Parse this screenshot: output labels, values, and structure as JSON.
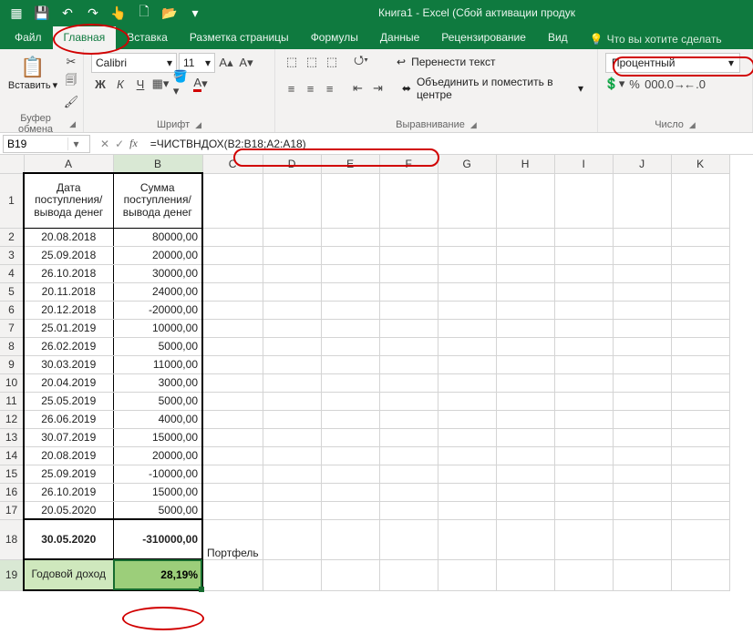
{
  "title": "Книга1 - Excel (Сбой активации продук",
  "qat": {
    "save": "💾",
    "undo": "↶",
    "redo": "↷",
    "touch": "👆",
    "new": "🗋",
    "open": "📂"
  },
  "tabs": {
    "file": "Файл",
    "home": "Главная",
    "insert": "Вставка",
    "layout": "Разметка страницы",
    "formulas": "Формулы",
    "data": "Данные",
    "review": "Рецензирование",
    "view": "Вид",
    "tellme": "Что вы хотите сделать"
  },
  "ribbon": {
    "clipboard": {
      "paste": "Вставить",
      "group": "Буфер обмена"
    },
    "font": {
      "name": "Calibri",
      "size": "11",
      "group": "Шрифт",
      "bold": "Ж",
      "italic": "К",
      "underline": "Ч"
    },
    "alignment": {
      "wrap": "Перенести текст",
      "merge": "Объединить и поместить в центре",
      "group": "Выравнивание"
    },
    "number": {
      "format": "Процентный",
      "group": "Число",
      "percent": "%",
      "comma": "000"
    }
  },
  "cellref": "B19",
  "formula": "=ЧИСТВНДОХ(B2:B18;A2:A18)",
  "columns": [
    "A",
    "B",
    "C",
    "D",
    "E",
    "F",
    "G",
    "H",
    "I",
    "J",
    "K"
  ],
  "headers": {
    "a": "Дата поступления/вывода денег",
    "b": "Сумма поступления/вывода денег"
  },
  "rows": [
    {
      "n": 2,
      "a": "20.08.2018",
      "b": "80000,00"
    },
    {
      "n": 3,
      "a": "25.09.2018",
      "b": "20000,00"
    },
    {
      "n": 4,
      "a": "26.10.2018",
      "b": "30000,00"
    },
    {
      "n": 5,
      "a": "20.11.2018",
      "b": "24000,00"
    },
    {
      "n": 6,
      "a": "20.12.2018",
      "b": "-20000,00"
    },
    {
      "n": 7,
      "a": "25.01.2019",
      "b": "10000,00"
    },
    {
      "n": 8,
      "a": "26.02.2019",
      "b": "5000,00"
    },
    {
      "n": 9,
      "a": "30.03.2019",
      "b": "11000,00"
    },
    {
      "n": 10,
      "a": "20.04.2019",
      "b": "3000,00"
    },
    {
      "n": 11,
      "a": "25.05.2019",
      "b": "5000,00"
    },
    {
      "n": 12,
      "a": "26.06.2019",
      "b": "4000,00"
    },
    {
      "n": 13,
      "a": "30.07.2019",
      "b": "15000,00"
    },
    {
      "n": 14,
      "a": "20.08.2019",
      "b": "20000,00"
    },
    {
      "n": 15,
      "a": "25.09.2019",
      "b": "-10000,00"
    },
    {
      "n": 16,
      "a": "26.10.2019",
      "b": "15000,00"
    },
    {
      "n": 17,
      "a": "20.05.2020",
      "b": "5000,00"
    }
  ],
  "row18": {
    "a": "30.05.2020",
    "b": "-310000,00",
    "c": "Портфель"
  },
  "row19": {
    "a": "Годовой доход",
    "b": "28,19%"
  }
}
